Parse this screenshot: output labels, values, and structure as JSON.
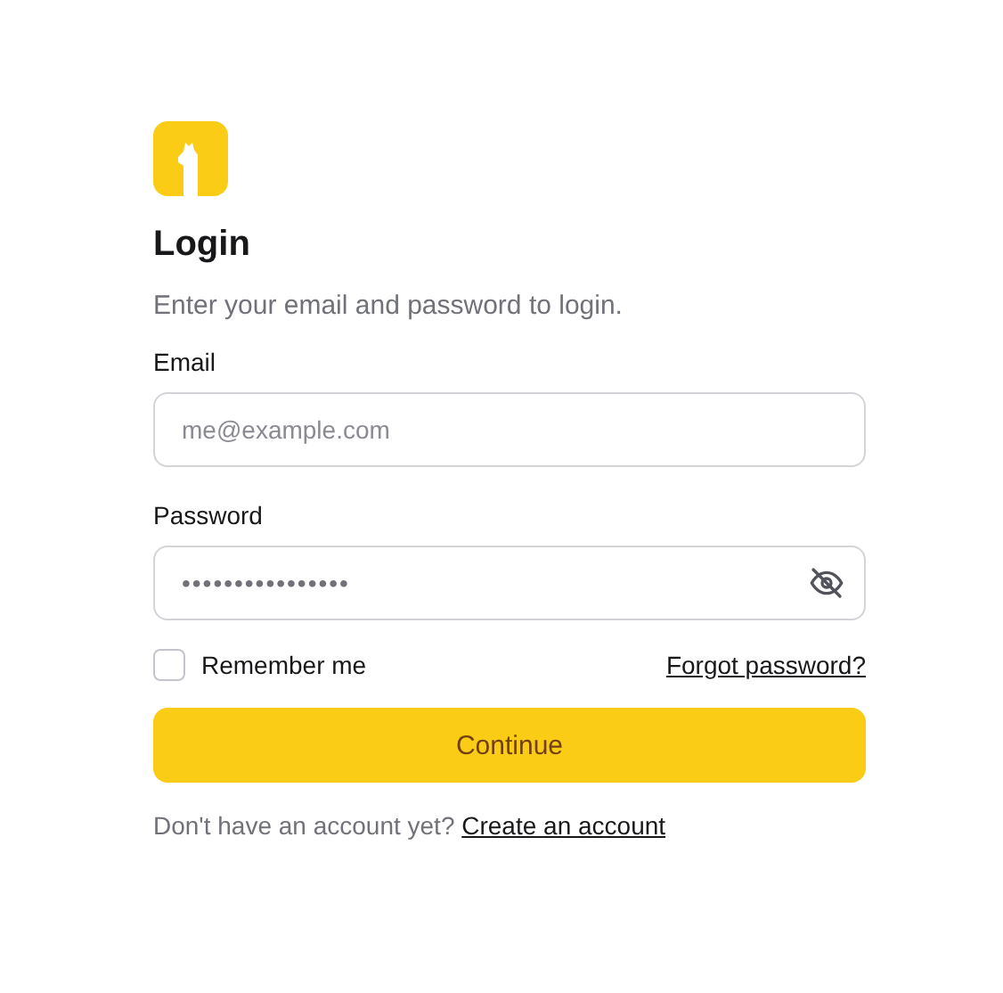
{
  "title": "Login",
  "subtitle": "Enter your email and password to login.",
  "email": {
    "label": "Email",
    "placeholder": "me@example.com"
  },
  "password": {
    "label": "Password",
    "value": "••••••••••••••••",
    "visible": false
  },
  "remember": {
    "label": "Remember me",
    "checked": false
  },
  "forgot_link": "Forgot password?",
  "submit": "Continue",
  "footer": {
    "text": "Don't have an account yet?",
    "link": "Create an account"
  }
}
